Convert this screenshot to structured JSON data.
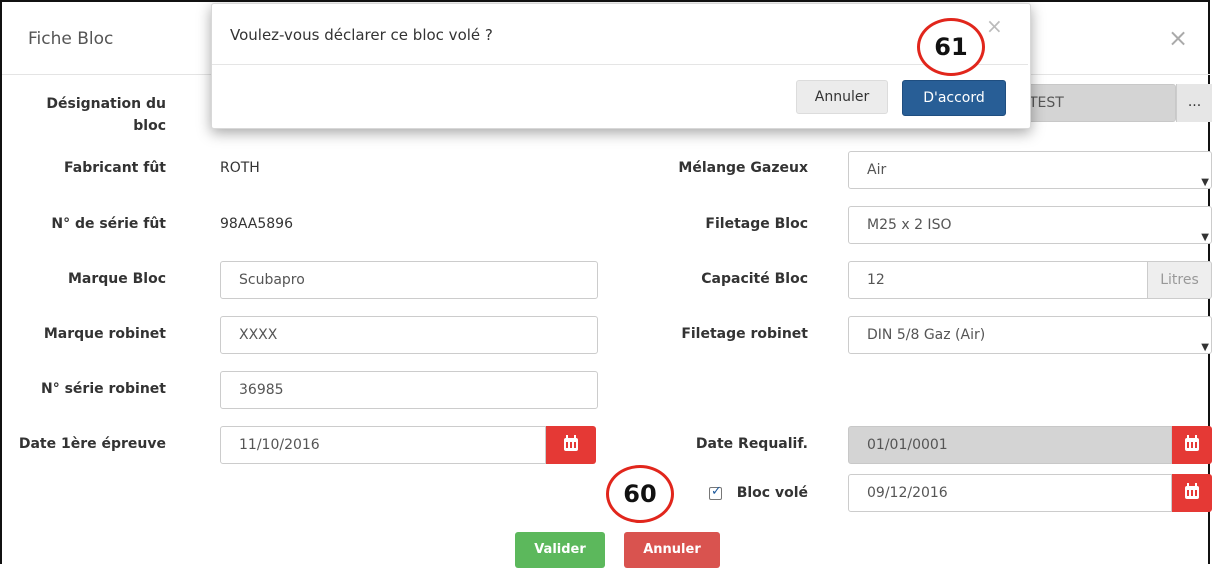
{
  "modal": {
    "title": "Fiche Bloc",
    "close_icon": "×"
  },
  "form": {
    "designation": {
      "label_line1": "Désignation du",
      "label_line2": "bloc",
      "value": "TEST",
      "button": "..."
    },
    "fabricant_fut": {
      "label": "Fabricant fût",
      "value": "ROTH"
    },
    "serie_fut": {
      "label": "N° de série fût",
      "value": "98AA5896"
    },
    "marque_bloc": {
      "label": "Marque Bloc",
      "value": "Scubapro"
    },
    "marque_robinet": {
      "label": "Marque robinet",
      "value": "XXXX"
    },
    "serie_robinet": {
      "label": "N° série robinet",
      "value": "36985"
    },
    "date_epreuve": {
      "label": "Date 1ère épreuve",
      "value": "11/10/2016",
      "icon": "calendar-icon"
    },
    "melange": {
      "label": "Mélange Gazeux",
      "value": "Air"
    },
    "filetage_bloc": {
      "label": "Filetage Bloc",
      "value": "M25 x 2 ISO"
    },
    "capacite": {
      "label": "Capacité Bloc",
      "value": "12",
      "unit": "Litres"
    },
    "filetage_robinet": {
      "label": "Filetage robinet",
      "value": "DIN 5/8 Gaz (Air)"
    },
    "date_requalif": {
      "label": "Date Requalif.",
      "value": "01/01/0001",
      "icon": "calendar-icon"
    },
    "bloc_vole": {
      "label": "Bloc volé",
      "checked": true,
      "date": "09/12/2016",
      "icon": "calendar-icon"
    }
  },
  "buttons": {
    "valider": "Valider",
    "annuler": "Annuler"
  },
  "confirm_dialog": {
    "message": "Voulez-vous déclarer ce bloc volé ?",
    "close_icon": "×",
    "cancel": "Annuler",
    "ok": "D'accord"
  },
  "callouts": {
    "top": "61",
    "bottom": "60",
    "color": "#e1261c"
  },
  "colors": {
    "calendar_button": "#e53935",
    "ok_button": "#285e96",
    "valider": "#5cb85c",
    "annuler": "#d9534f"
  }
}
